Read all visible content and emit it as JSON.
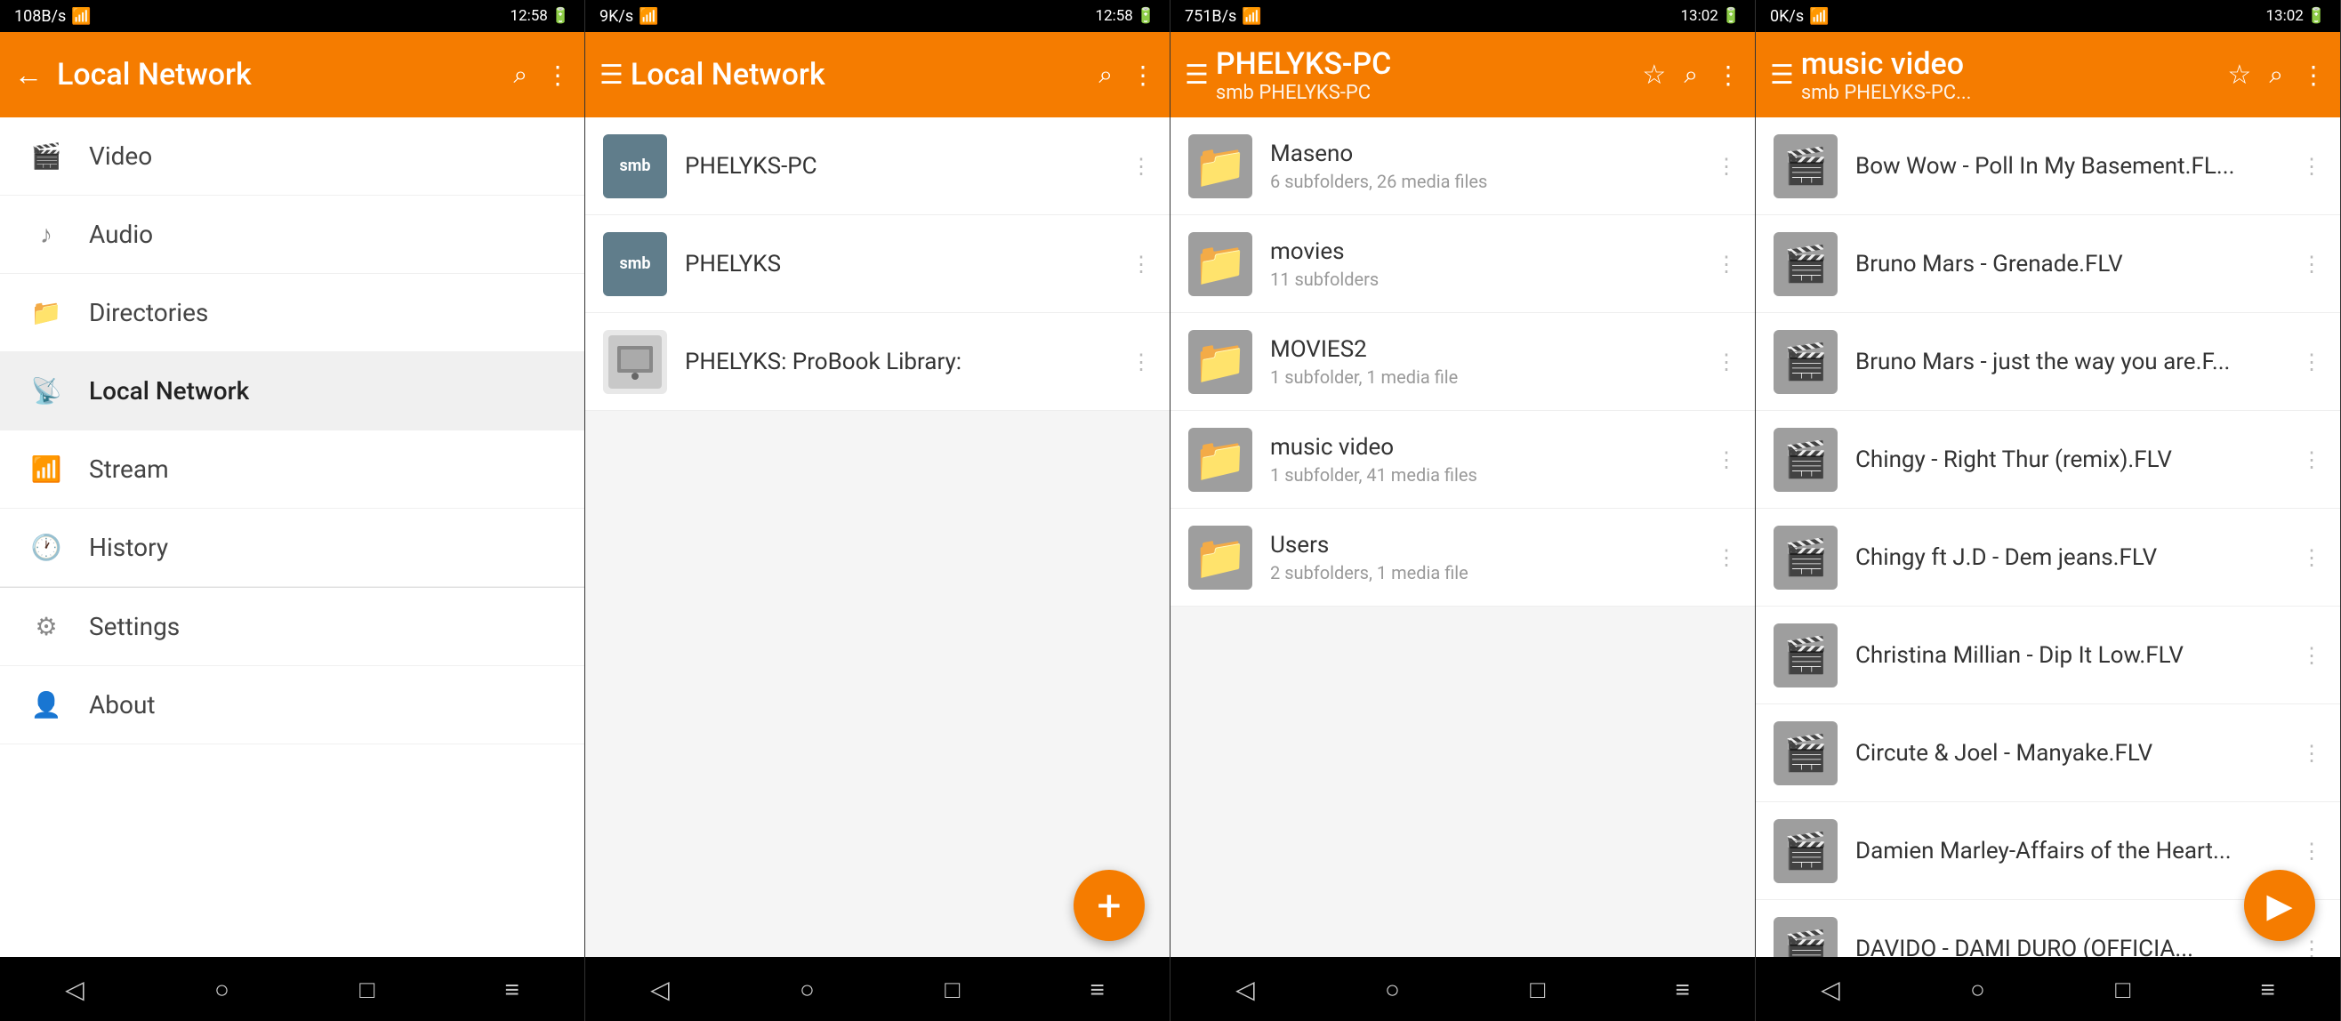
{
  "panel1": {
    "status": {
      "left": "108B/s",
      "time": "12:58",
      "battery": "82%"
    },
    "header": {
      "title": "Local Network",
      "back_icon": "←",
      "search_icon": "⌕",
      "more_icon": "⋮"
    },
    "menu": [
      {
        "id": "video",
        "label": "Video",
        "icon": "🎬"
      },
      {
        "id": "audio",
        "label": "Audio",
        "icon": "♪"
      },
      {
        "id": "directories",
        "label": "Directories",
        "icon": "📁"
      },
      {
        "id": "local-network",
        "label": "Local Network",
        "icon": "📡",
        "active": true
      },
      {
        "id": "stream",
        "label": "Stream",
        "icon": "📶"
      },
      {
        "id": "history",
        "label": "History",
        "icon": "🕐"
      },
      {
        "id": "settings",
        "label": "Settings",
        "icon": "⚙"
      },
      {
        "id": "about",
        "label": "About",
        "icon": "👤"
      }
    ]
  },
  "panel2": {
    "status": {
      "left": "9K/s",
      "time": "12:58",
      "battery": "82%"
    },
    "header": {
      "title": "Local Network",
      "menu_icon": "☰",
      "search_icon": "⌕",
      "more_icon": "⋮"
    },
    "items": [
      {
        "id": "phelyks-pc",
        "badge": "smb",
        "name": "PHELYKS-PC",
        "sub": ""
      },
      {
        "id": "phelyks",
        "badge": "smb",
        "name": "PHELYKS",
        "sub": ""
      },
      {
        "id": "probook",
        "badge": "img",
        "name": "PHELYKS: ProBook Library:",
        "sub": ""
      }
    ],
    "fab_label": "+"
  },
  "panel3": {
    "status": {
      "left": "751B/s",
      "time": "13:02",
      "battery": "81%"
    },
    "header": {
      "title": "PHELYKS-PC",
      "subtitle": "smb PHELYKS-PC",
      "menu_icon": "☰",
      "star_icon": "☆",
      "search_icon": "⌕",
      "more_icon": "⋮"
    },
    "folders": [
      {
        "id": "maseno",
        "name": "Maseno",
        "sub": "6 subfolders, 26 media files"
      },
      {
        "id": "movies",
        "name": "movies",
        "sub": "11 subfolders"
      },
      {
        "id": "movies2",
        "name": "MOVIES2",
        "sub": "1 subfolder, 1 media file"
      },
      {
        "id": "music-video",
        "name": "music video",
        "sub": "1 subfolder, 41 media files"
      },
      {
        "id": "users",
        "name": "Users",
        "sub": "2 subfolders, 1 media file"
      }
    ]
  },
  "panel4": {
    "status": {
      "left": "0K/s",
      "time": "13:02",
      "battery": "81%"
    },
    "header": {
      "title": "music video",
      "subtitle": "smb PHELYKS-PC...",
      "menu_icon": "☰",
      "star_icon": "☆",
      "search_icon": "⌕",
      "more_icon": "⋮"
    },
    "files": [
      {
        "id": "bow-wow",
        "name": "Bow Wow - Poll In  My Basement.FL..."
      },
      {
        "id": "bruno-mars-grenade",
        "name": "Bruno Mars - Grenade.FLV"
      },
      {
        "id": "bruno-mars-just",
        "name": "Bruno Mars - just the way you are.F..."
      },
      {
        "id": "chingy-right",
        "name": "Chingy - Right Thur (remix).FLV"
      },
      {
        "id": "chingy-dem",
        "name": "Chingy ft J.D - Dem jeans.FLV"
      },
      {
        "id": "christina",
        "name": "Christina Millian - Dip It Low.FLV"
      },
      {
        "id": "circute",
        "name": "Circute & Joel - Manyake.FLV"
      },
      {
        "id": "damien",
        "name": "Damien Marley-Affairs of the Heart..."
      },
      {
        "id": "davido",
        "name": "DAVIDO - DAMI DURO (OFFICIA..."
      }
    ],
    "play_icon": "▶"
  },
  "bottom_nav": {
    "back": "◁",
    "home": "○",
    "recent": "□",
    "menu": "≡"
  }
}
